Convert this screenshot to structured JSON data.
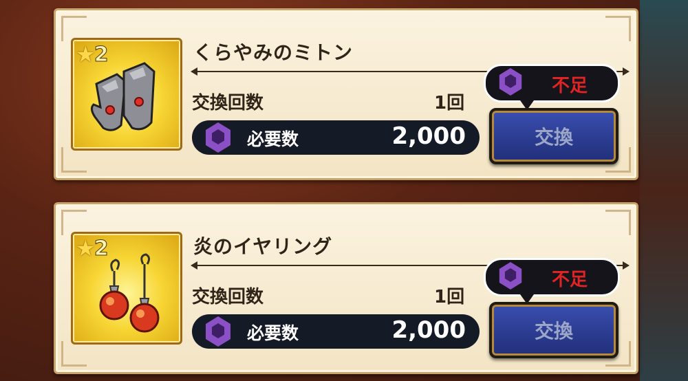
{
  "items": [
    {
      "rarity": "2",
      "name": "くらやみのミトン",
      "count_label": "交換回数",
      "count_value": "1回",
      "cost_label": "必要数",
      "cost_value": "2,000",
      "insufficient_label": "不足",
      "exchange_label": "交換",
      "icon": "gauntlets-icon"
    },
    {
      "rarity": "2",
      "name": "炎のイヤリング",
      "count_label": "交換回数",
      "count_value": "1回",
      "cost_label": "必要数",
      "cost_value": "2,000",
      "insufficient_label": "不足",
      "exchange_label": "交換",
      "icon": "earrings-icon"
    }
  ],
  "colors": {
    "gem": "#8b4fc6",
    "insufficient_text": "#e02424",
    "button": "#2a3a8e",
    "card": "#f3e4c4"
  }
}
